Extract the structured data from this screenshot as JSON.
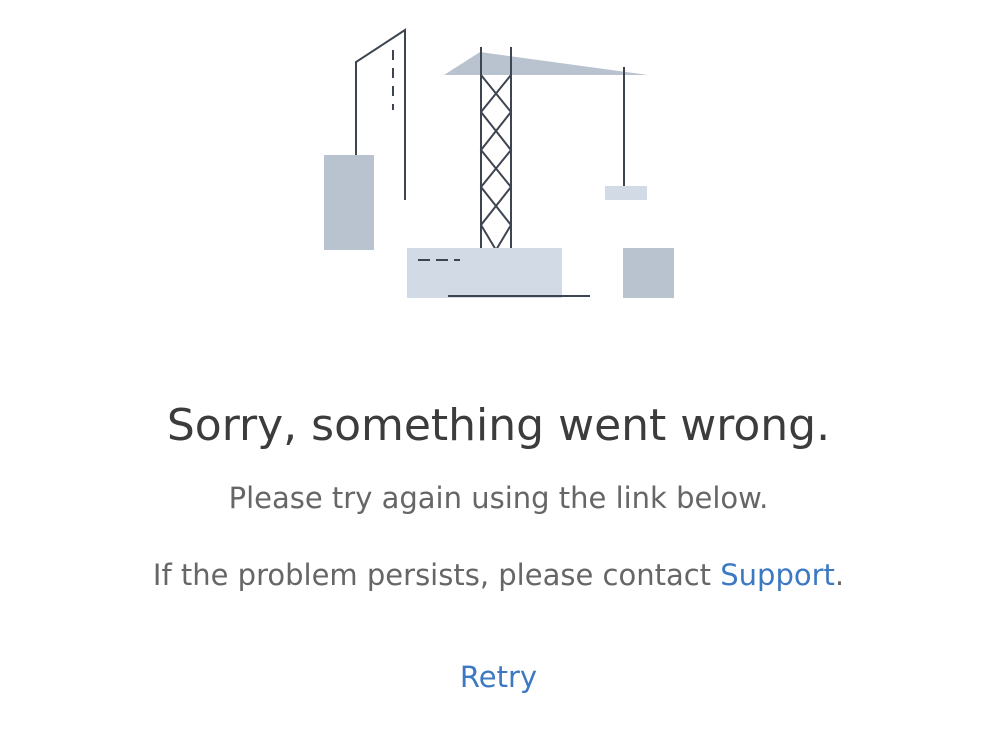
{
  "error": {
    "heading": "Sorry, something went wrong.",
    "message": "Please try again using the link below.",
    "contact_prefix": "If the problem persists, please contact ",
    "support_link": "Support",
    "contact_suffix": ".",
    "retry_label": "Retry"
  },
  "colors": {
    "heading_text": "#3c3c3c",
    "body_text": "#666666",
    "link": "#3d79c2",
    "illustration_dark": "#b9c3cf",
    "illustration_light": "#d2dbe5",
    "illustration_line": "#3c4550"
  },
  "illustration": {
    "icon": "construction-crane-illustration"
  }
}
